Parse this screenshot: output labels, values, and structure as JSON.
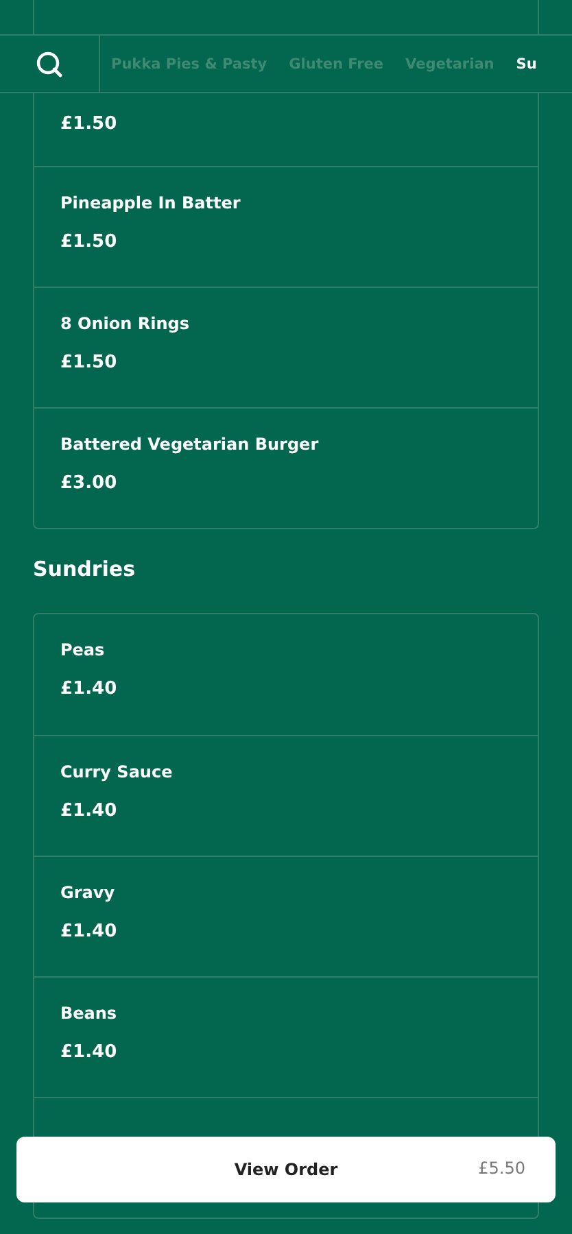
{
  "tabs": [
    {
      "label": "Pukka Pies & Pasty",
      "selected": false
    },
    {
      "label": "Gluten Free",
      "selected": false
    },
    {
      "label": "Vegetarian",
      "selected": false
    },
    {
      "label": "Su",
      "selected": true
    }
  ],
  "sections": [
    {
      "items": [
        {
          "price": "£1.50"
        },
        {
          "name": "Pineapple In Batter",
          "price": "£1.50"
        },
        {
          "name": "8 Onion Rings",
          "price": "£1.50"
        },
        {
          "name": "Battered Vegetarian Burger",
          "price": "£3.00"
        }
      ]
    },
    {
      "title": "Sundries",
      "items": [
        {
          "name": "Peas",
          "price": "£1.40"
        },
        {
          "name": "Curry Sauce",
          "price": "£1.40"
        },
        {
          "name": "Gravy",
          "price": "£1.40"
        },
        {
          "name": "Beans",
          "price": "£1.40"
        }
      ]
    }
  ],
  "order_bar": {
    "label": "View Order",
    "total": "£5.50"
  }
}
